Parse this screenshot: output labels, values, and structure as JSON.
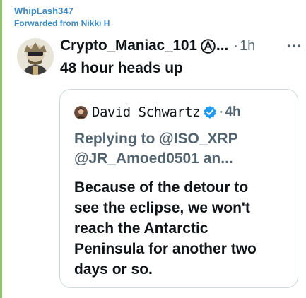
{
  "message": {
    "sender": "WhipLash347",
    "forwarded_from": "Forwarded from Nikki H",
    "accent_color": "#3c8ac4"
  },
  "tweet": {
    "author": "Crypto_Maniac_101",
    "author_badge_icon": "anarchy-circle-icon",
    "ellipsis": "...",
    "dot": "·",
    "time": "1h",
    "more_icon": "more-dots-icon",
    "text": "48 hour heads up"
  },
  "quoted_tweet": {
    "author": "David Schwartz",
    "verified_icon": "verified-badge-icon",
    "verified_color": "#1d9bf0",
    "dot": "·",
    "time": "4h",
    "replying_line1": "Replying to @ISO_XRP",
    "replying_line2": "@JR_Amoed0501 an...",
    "body_lines": [
      "Because of the detour to",
      "see the eclipse, we won't",
      "reach the Antarctic",
      "Peninsula for another two",
      "days or so."
    ]
  }
}
